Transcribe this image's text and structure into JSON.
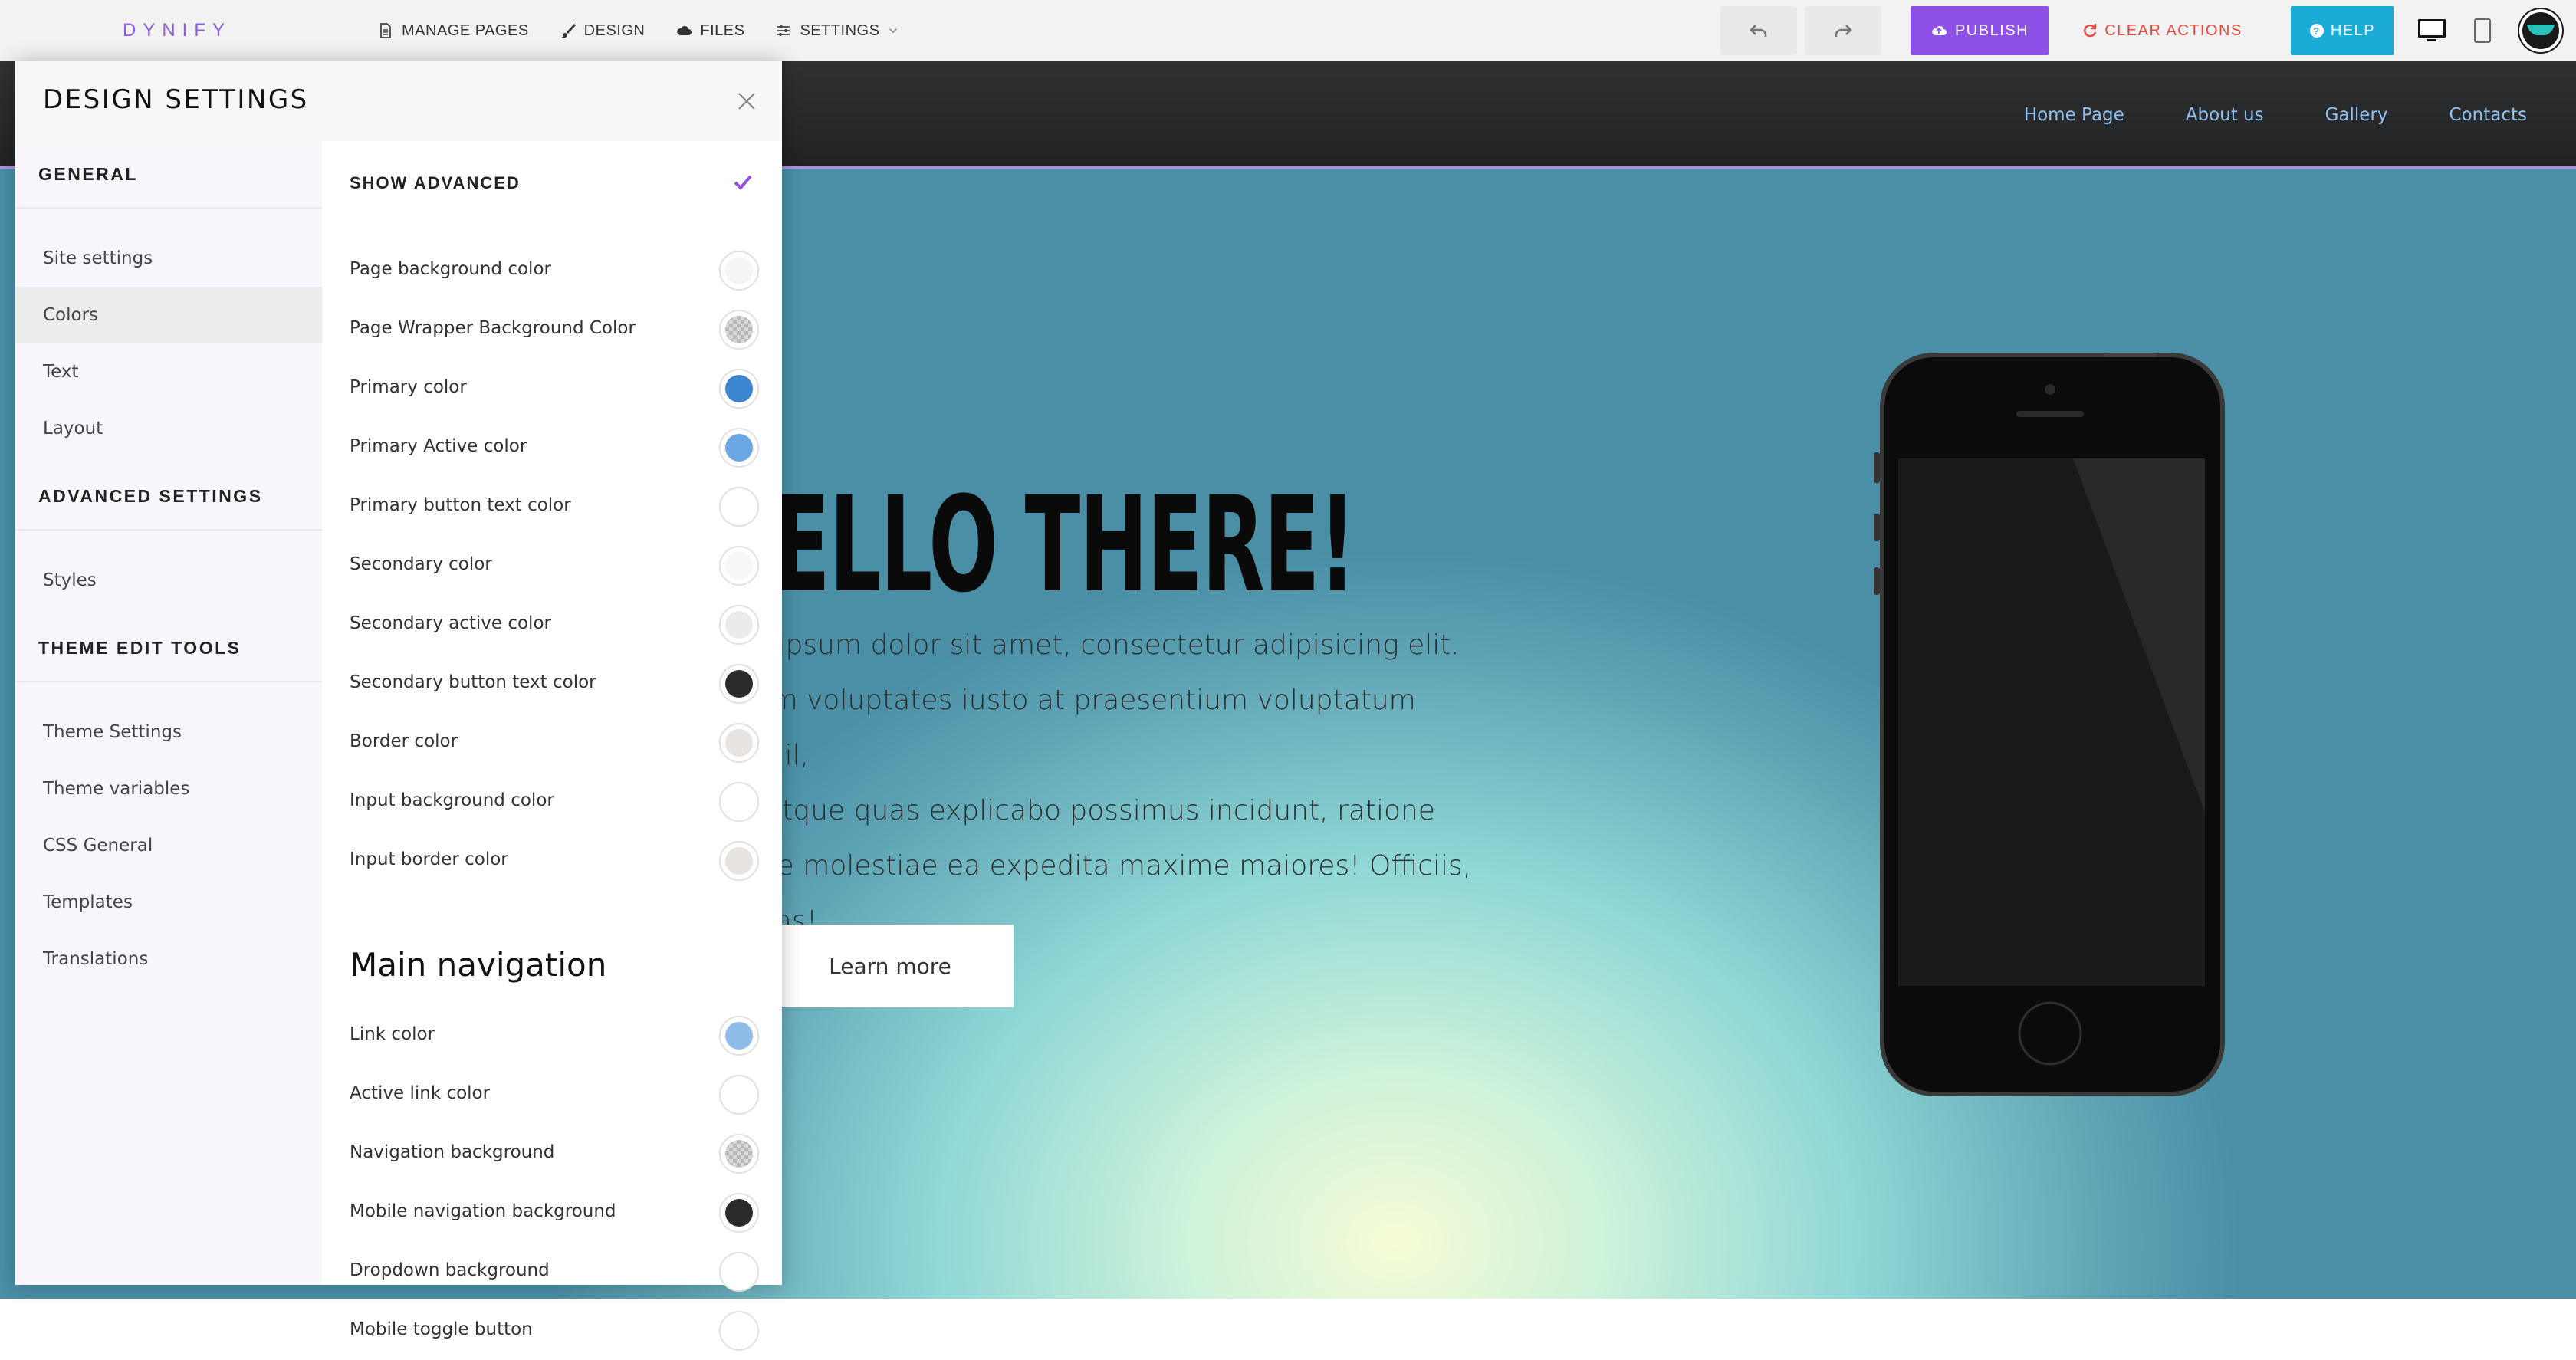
{
  "app": {
    "logo": "DYNIFY"
  },
  "toolbar": {
    "menu": [
      {
        "label": "MANAGE PAGES",
        "icon": "document-icon"
      },
      {
        "label": "DESIGN",
        "icon": "brush-icon"
      },
      {
        "label": "FILES",
        "icon": "cloud-icon"
      },
      {
        "label": "SETTINGS",
        "icon": "sliders-icon"
      }
    ],
    "publish_label": "PUBLISH",
    "clear_label": "CLEAR ACTIONS",
    "help_label": "HELP",
    "colors": {
      "publish": "#8e50e6",
      "clear": "#e5483e",
      "help": "#1aabd6"
    }
  },
  "site": {
    "nav_links": [
      "Home Page",
      "About us",
      "Gallery",
      "Contacts"
    ],
    "hero_title": "ELLO THERE!",
    "hero_lines": [
      "m ipsum dolor sit amet, consectetur adipisicing elit.",
      "rum voluptates iusto at praesentium voluptatum nihil,",
      "s atque quas explicabo possimus incidunt, ratione",
      "que molestiae ea expedita maxime maiores! Officiis,",
      "stias!"
    ],
    "button_label": "Learn more"
  },
  "panel": {
    "title": "DESIGN SETTINGS",
    "sidebar": {
      "general_heading": "GENERAL",
      "general_items": [
        "Site settings",
        "Colors",
        "Text",
        "Layout"
      ],
      "active_item": "Colors",
      "advanced_heading": "ADVANCED SETTINGS",
      "advanced_items": [
        "Styles"
      ],
      "theme_heading": "THEME EDIT TOOLS",
      "theme_items": [
        "Theme Settings",
        "Theme variables",
        "CSS General",
        "Templates",
        "Translations"
      ]
    },
    "show_advanced_label": "SHOW ADVANCED",
    "show_advanced_checked": true,
    "colors": [
      {
        "label": "Page background color",
        "value": "#f5f5f5"
      },
      {
        "label": "Page Wrapper Background Color",
        "value": "transparent"
      },
      {
        "label": "Primary color",
        "value": "#3d84d1"
      },
      {
        "label": "Primary Active color",
        "value": "#6aa7e2"
      },
      {
        "label": "Primary button text color",
        "value": "#ffffff"
      },
      {
        "label": "Secondary color",
        "value": "#f7f7f7"
      },
      {
        "label": "Secondary active color",
        "value": "#ebebeb"
      },
      {
        "label": "Secondary button text color",
        "value": "#2a2a2a"
      },
      {
        "label": "Border color",
        "value": "#e6e3e1"
      },
      {
        "label": "Input background color",
        "value": "#ffffff"
      },
      {
        "label": "Input border color",
        "value": "#e6e3e1"
      }
    ],
    "nav_section_title": "Main navigation",
    "nav_colors": [
      {
        "label": "Link color",
        "value": "#8fbde9"
      },
      {
        "label": "Active link color",
        "value": "#ffffff"
      },
      {
        "label": "Navigation background",
        "value": "transparent"
      },
      {
        "label": "Mobile navigation background",
        "value": "#2a2a2a"
      },
      {
        "label": "Dropdown background",
        "value": "#ffffff"
      },
      {
        "label": "Mobile toggle button",
        "value": "#ffffff"
      }
    ]
  }
}
